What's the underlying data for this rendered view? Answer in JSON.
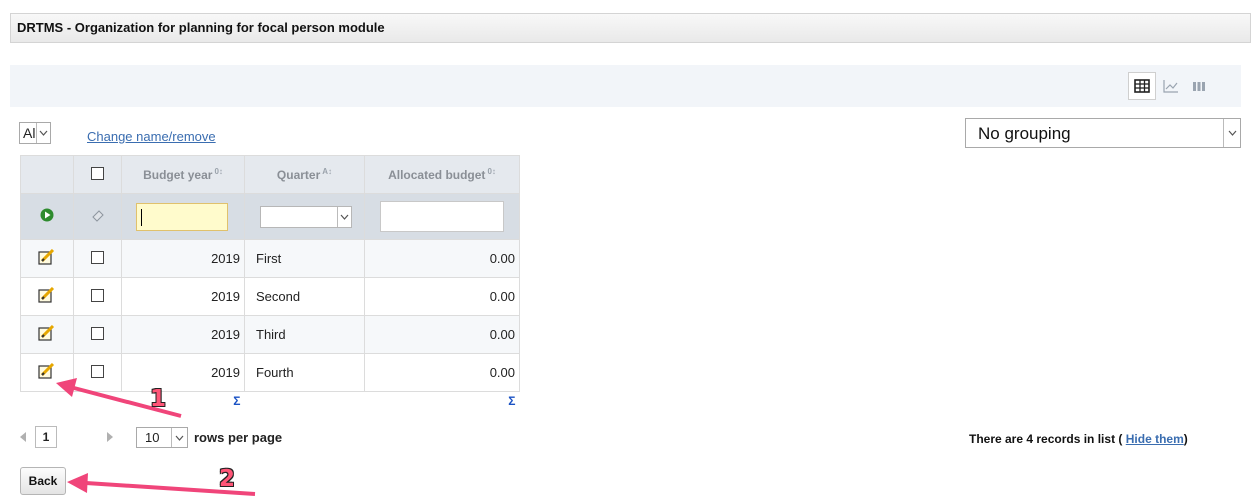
{
  "window": {
    "title": "DRTMS - Organization for planning for focal person module"
  },
  "view_toggle": {
    "items": [
      "table-view",
      "chart-view",
      "column-view"
    ],
    "active": "table-view"
  },
  "filter": {
    "selected": "All",
    "change_link": "Change name/remove"
  },
  "grouping": {
    "selected": "No grouping"
  },
  "table": {
    "columns": [
      "Budget year",
      "Quarter",
      "Allocated budget"
    ],
    "rows": [
      {
        "year": "2019",
        "quarter": "First",
        "budget": "0.00"
      },
      {
        "year": "2019",
        "quarter": "Second",
        "budget": "0.00"
      },
      {
        "year": "2019",
        "quarter": "Third",
        "budget": "0.00"
      },
      {
        "year": "2019",
        "quarter": "Fourth",
        "budget": "0.00"
      }
    ],
    "sum_symbol": "Σ"
  },
  "pager": {
    "page": "1",
    "rows_per_page": "10",
    "rows_label": "rows per page"
  },
  "records": {
    "text": "There are 4 records in list (",
    "hide_link": "Hide them",
    "close": ")"
  },
  "back_button": "Back",
  "annotations": {
    "marker_1": "1",
    "marker_2": "2"
  },
  "colors": {
    "annotation_arrow": "#f0457a",
    "sum_symbol": "#1a52c4",
    "link": "#3a6db0",
    "filter_input": "#fffbcc"
  }
}
